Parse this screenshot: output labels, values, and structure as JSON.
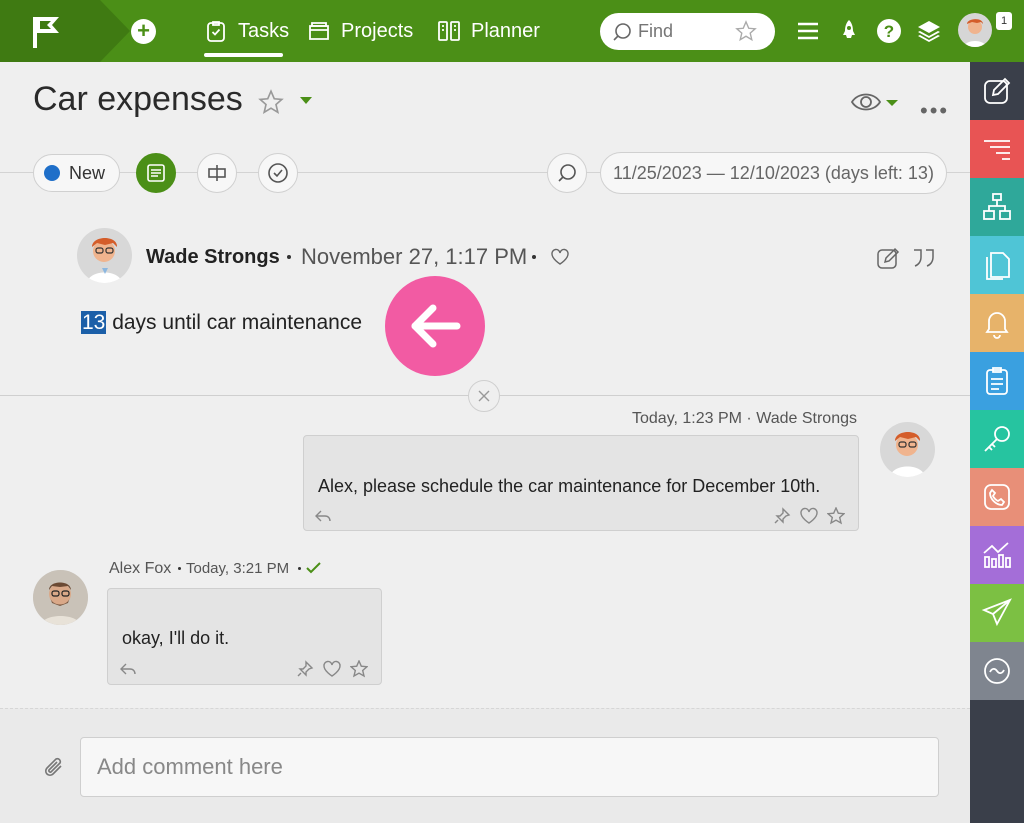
{
  "topbar": {
    "nav": {
      "tasks": "Tasks",
      "projects": "Projects",
      "planner": "Planner"
    },
    "search_placeholder": "Find",
    "notification_count": "1"
  },
  "task": {
    "title": "Car expenses",
    "status": "New",
    "date_range": "11/25/2023 — 12/10/2023  (days left: 13)"
  },
  "description": {
    "author": "Wade Strongs",
    "date": "November 27, 1:17 PM",
    "highlight": "13",
    "text": " days until car maintenance"
  },
  "comments": [
    {
      "meta": "Today, 1:23 PM · Wade Strongs",
      "text": "Alex, please schedule the car maintenance for December 10th."
    },
    {
      "author": "Alex Fox",
      "time": "Today, 3:21 PM",
      "text": "okay, I'll do it."
    }
  ],
  "composer": {
    "placeholder": "Add comment here"
  },
  "colors": {
    "brand_green": "#4b8f17",
    "highlight_pink": "#f25ba3",
    "rail": [
      "#3a3f4a",
      "#e85454",
      "#2fa89a",
      "#4fc5d6",
      "#e7b36a",
      "#3aa0e0",
      "#26c4a0",
      "#e88f78",
      "#a46ed8",
      "#7cc043",
      "#7f858f"
    ]
  }
}
